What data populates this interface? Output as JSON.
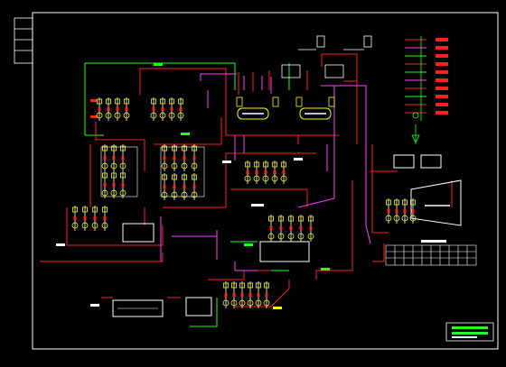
{
  "drawing": {
    "background": "#000000",
    "frame_color": "#ffffff"
  },
  "colors": {
    "supply": "#ff2020",
    "return": "#ff40ff",
    "cold": "#20ff20",
    "white": "#ffffff",
    "yellow": "#ffff00",
    "cyan": "#00ffff",
    "green": "#00ff40"
  },
  "equipment": {
    "left_unit": {
      "label": ""
    },
    "boiler_a": {
      "label": ""
    },
    "boiler_b": {
      "label": ""
    },
    "center_tank": {
      "label": ""
    },
    "bottom_left_tank": {
      "label": ""
    },
    "bottom_mid_tank": {
      "label": ""
    },
    "right_box_a": {
      "label": ""
    },
    "right_box_b": {
      "label": ""
    },
    "exchanger": {
      "label": ""
    }
  },
  "legend": {
    "entries": [
      {
        "label": ""
      },
      {
        "label": ""
      },
      {
        "label": ""
      },
      {
        "label": ""
      },
      {
        "label": ""
      },
      {
        "label": ""
      },
      {
        "label": ""
      },
      {
        "label": ""
      },
      {
        "label": ""
      },
      {
        "label": ""
      }
    ]
  },
  "icons": {
    "pump_group": "pump-group-icon",
    "valve": "valve-icon",
    "title_block": "title-block-icon"
  }
}
